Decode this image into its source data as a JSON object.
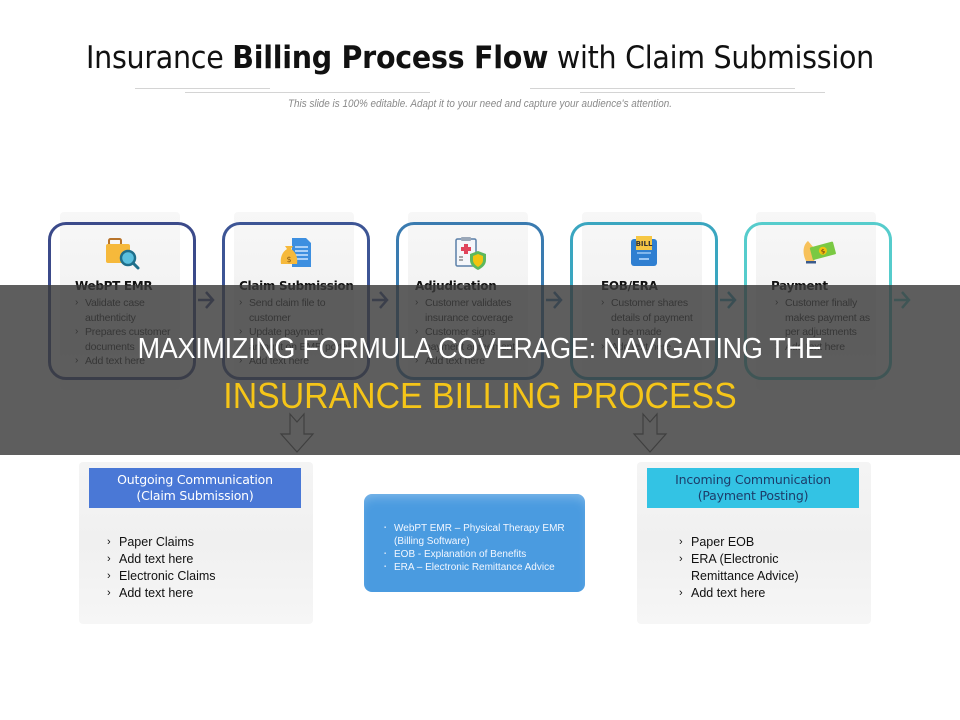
{
  "slide": {
    "title_parts": {
      "pre": "Insurance ",
      "bold": "Billing Process Flow",
      "post": " with Claim Submission"
    },
    "subtitle": "This slide is 100% editable. Adapt it to your need and capture your audience's attention."
  },
  "steps": [
    {
      "title": "WebPT EMR",
      "icon": "briefcase-search-icon",
      "border_color": "#3b4a8a",
      "items": [
        "Validate case authenticity",
        "Prepares customer documents",
        "Add text here"
      ]
    },
    {
      "title": "Claim Submission",
      "icon": "money-bag-document-icon",
      "border_color": "#3d5595",
      "items": [
        "Send claim file to customer",
        "Update payment amount on EMR portal",
        "Add text here"
      ]
    },
    {
      "title": "Adjudication",
      "icon": "medical-clipboard-shield-icon",
      "border_color": "#3a7bb0",
      "items": [
        "Customer validates insurance coverage",
        "Customer signs payment agreement",
        "Add text here"
      ]
    },
    {
      "title": "EOB/ERA",
      "icon": "bill-icon",
      "border_color": "#3aa6c0",
      "items": [
        "Customer shares details of payment to be made",
        "Add text here"
      ]
    },
    {
      "title": "Payment",
      "icon": "hand-money-icon",
      "border_color": "#56cccc",
      "items": [
        "Customer finally makes payment as per adjustments",
        "Add text here"
      ]
    }
  ],
  "panels": {
    "outgoing": {
      "heading_line1": "Outgoing Communication",
      "heading_line2": "(Claim Submission)",
      "heading_bg": "#4a78d6",
      "heading_color": "#ffffff",
      "items": [
        "Paper Claims",
        "Add text here",
        "Electronic Claims",
        "Add text here"
      ]
    },
    "incoming": {
      "heading_line1": "Incoming Communication",
      "heading_line2": "(Payment Posting)",
      "heading_bg": "#33c3e4",
      "heading_color": "#1d3d6a",
      "items": [
        "Paper EOB",
        "ERA (Electronic Remittance Advice)",
        "Add text here"
      ]
    },
    "glossary": {
      "bg": "#4a9be0",
      "items": [
        "WebPT EMR – Physical Therapy EMR (Billing Software)",
        "EOB - Explanation of Benefits",
        "ERA – Electronic Remittance Advice"
      ]
    }
  },
  "overlay": {
    "line1": "MAXIMIZING FORMULA COVERAGE: NAVIGATING THE",
    "line2": "INSURANCE BILLING PROCESS",
    "line2_color": "#f5c518"
  }
}
